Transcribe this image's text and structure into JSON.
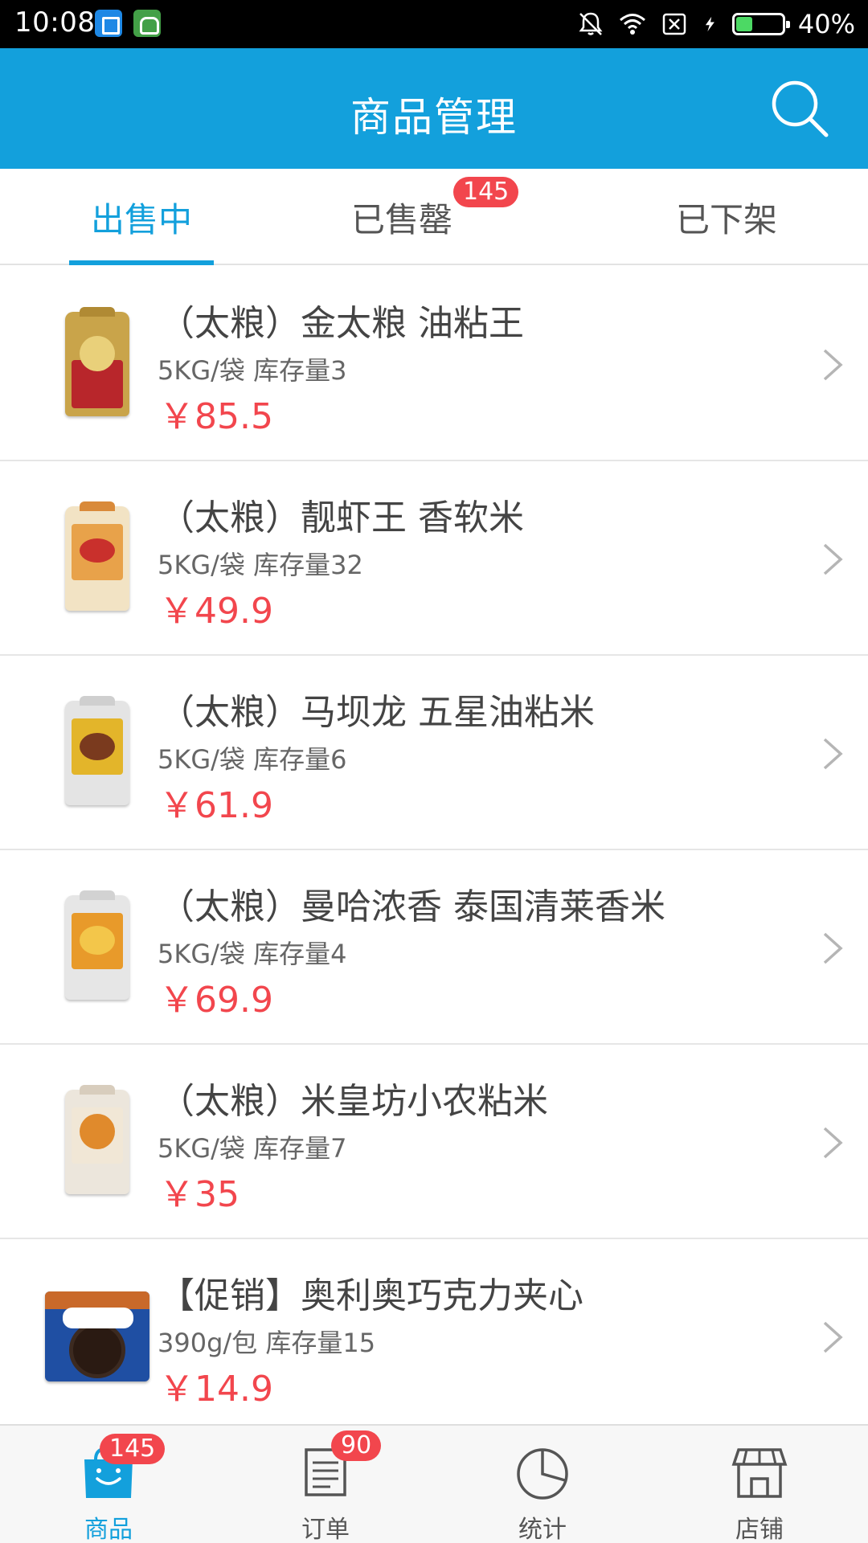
{
  "status_bar": {
    "time": "10:08",
    "battery_percent": "40%",
    "battery_level": 0.4,
    "icons": [
      "app-icon-blue",
      "app-icon-green",
      "mute-icon",
      "wifi-icon",
      "no-sim-icon",
      "charging-icon",
      "battery-icon"
    ]
  },
  "header": {
    "title": "商品管理",
    "search_icon": "search-icon"
  },
  "tabs": [
    {
      "label": "出售中",
      "active": true
    },
    {
      "label": "已售罄",
      "badge": "145",
      "active": false
    },
    {
      "label": "已下架",
      "active": false
    }
  ],
  "products": [
    {
      "name": "（太粮）金太粮 油粘王",
      "spec": "5KG/袋 库存量3",
      "price": "￥85.5"
    },
    {
      "name": "（太粮）靓虾王 香软米",
      "spec": "5KG/袋 库存量32",
      "price": "￥49.9"
    },
    {
      "name": "（太粮）马坝龙 五星油粘米",
      "spec": "5KG/袋 库存量6",
      "price": "￥61.9"
    },
    {
      "name": "（太粮）曼哈浓香 泰国清莱香米",
      "spec": "5KG/袋 库存量4",
      "price": "￥69.9"
    },
    {
      "name": "（太粮）米皇坊小农粘米",
      "spec": "5KG/袋 库存量7",
      "price": "￥35"
    },
    {
      "name": "【促销】奥利奥巧克力夹心",
      "spec": "390g/包 库存量15",
      "price": "￥14.9"
    }
  ],
  "bottom_nav": [
    {
      "label": "商品",
      "icon": "shopping-bag-icon",
      "badge": "145",
      "active": true
    },
    {
      "label": "订单",
      "icon": "order-list-icon",
      "badge": "90",
      "active": false
    },
    {
      "label": "统计",
      "icon": "pie-chart-icon",
      "active": false
    },
    {
      "label": "店铺",
      "icon": "storefront-icon",
      "active": false
    }
  ],
  "colors": {
    "primary": "#13a0dc",
    "price": "#f2464d",
    "badge": "#f2464d",
    "text": "#444444",
    "subtext": "#666666"
  }
}
